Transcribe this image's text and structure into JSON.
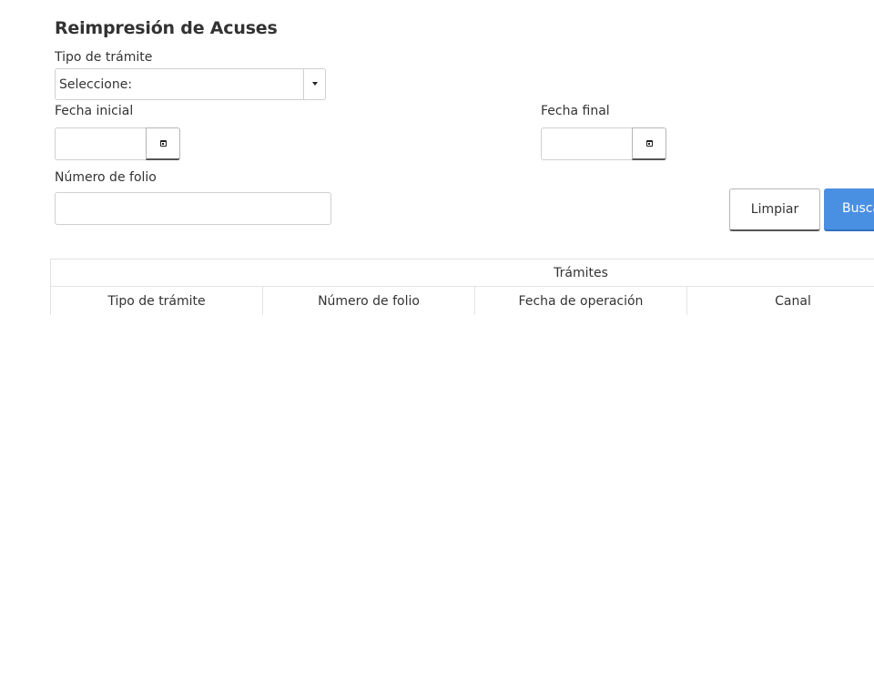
{
  "form": {
    "title": "Reimpresión de Acuses",
    "tipo_label": "Tipo de trámite",
    "tipo_selected": "Seleccione:",
    "fecha_inicial_label": "Fecha inicial",
    "fecha_inicial_value": "",
    "fecha_final_label": "Fecha final",
    "fecha_final_value": "",
    "folio_label": "Número de folio",
    "folio_value": ""
  },
  "buttons": {
    "clear_label": "Limpiar",
    "search_label": "Buscar"
  },
  "icons": {
    "calendar": "calendar-icon",
    "dropdown": "caret-down-icon"
  },
  "table": {
    "caption": "Trámites",
    "columns": [
      "Tipo de trámite",
      "Número de folio",
      "Fecha de operación",
      "Canal",
      ""
    ],
    "rows": []
  },
  "colors": {
    "primary": "#4a90e2",
    "border": "#cfcfcf",
    "text": "#333333"
  }
}
